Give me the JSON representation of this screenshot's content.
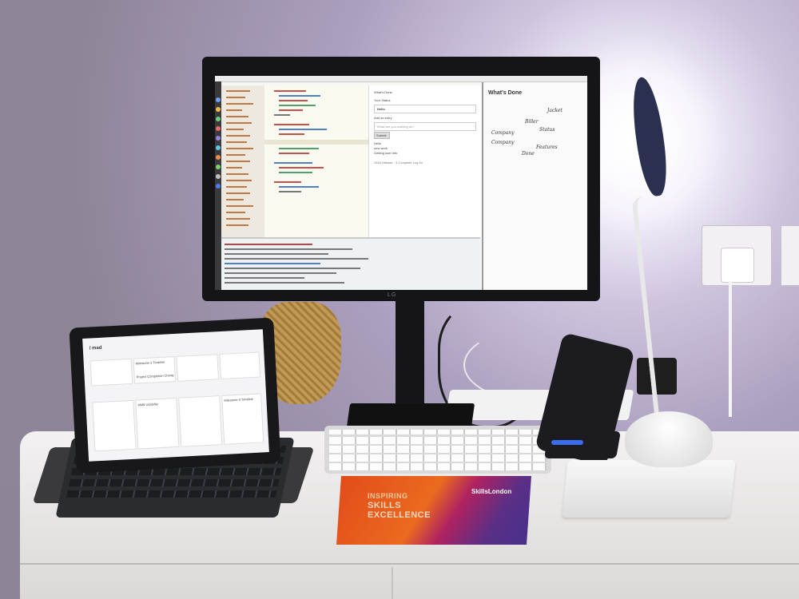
{
  "monitor": {
    "brand": "LG",
    "app_panel": {
      "title": "What's Done",
      "status_label": "Your Status",
      "status_value": "Hello",
      "add_entry_label": "Add an entry",
      "add_entry_placeholder": "What are you working on?",
      "submit_label": "Submit",
      "list_items": [
        "Hello",
        "new work",
        "Getting user info"
      ],
      "footer": "1518 Hakase · 3 Complete Log All"
    },
    "notes_panel": {
      "title": "What's Done",
      "handwriting": [
        "Jacket",
        "Biller",
        "Company",
        "Company",
        "Done",
        "Status",
        "Features"
      ]
    }
  },
  "cloth": {
    "line1": "INSPIRING",
    "line2": "SKILLS",
    "line3": "EXCELLENCE",
    "brand": "SkillsLondon"
  },
  "ipad": {
    "header": "/ mad",
    "cards": [
      "Milestone 3 Timeline",
      "Project Completion Cheng",
      "MM6 Usability",
      "Milestone 5 Timeline"
    ]
  },
  "colors": {
    "wall": "#ab9fbf",
    "desk": "#f0eeee",
    "cloth_orange": "#e8581c",
    "cloth_purple": "#5b2f86",
    "charger_led": "#3a6df0"
  }
}
